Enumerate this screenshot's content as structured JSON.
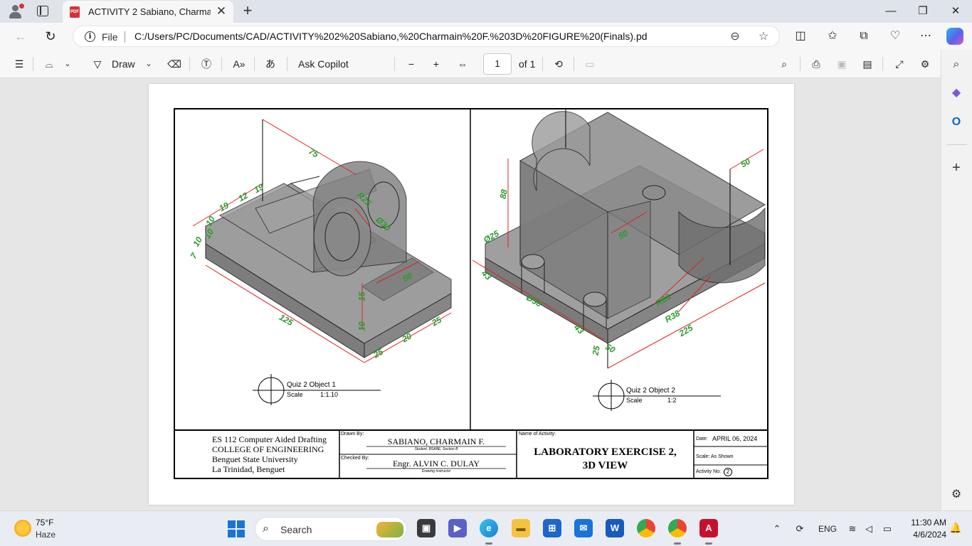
{
  "tab": {
    "title": "ACTIVITY 2 Sabiano, Charmain F.",
    "close": "✕",
    "new_tab": "+"
  },
  "window": {
    "minimize": "—",
    "restore": "❐",
    "close": "✕"
  },
  "address": {
    "file_label": "File",
    "url": "C:/Users/PC/Documents/CAD/ACTIVITY%202%20Sabiano,%20Charmain%20F.%203D%20FIGURE%20(Finals).pdf"
  },
  "pdf_toolbar": {
    "draw": "Draw",
    "ask_copilot": "Ask Copilot",
    "page_current": "1",
    "page_total": "of 1"
  },
  "drawing": {
    "object1": {
      "title": "Quiz 2 Object 1",
      "scale_label": "Scale",
      "scale_value": "1:1.10",
      "dims": [
        "75",
        "19",
        "12",
        "19",
        "10",
        "10",
        "10",
        "7",
        "R25",
        "Ø30",
        "50",
        "15",
        "10",
        "125",
        "25",
        "20",
        "25"
      ]
    },
    "object2": {
      "title": "Quiz 2 Object 2",
      "scale_label": "Scale",
      "scale_value": "1:2",
      "dims": [
        "50",
        "88",
        "Ø25",
        "50",
        "43",
        "Ø30",
        "R63",
        "R38",
        "225",
        "43",
        "25",
        "50"
      ]
    },
    "titleblock": {
      "course": "ES 112 Computer Aided Drafting",
      "college": "COLLEGE OF ENGINEERING",
      "university": "Benguet State University",
      "location": "La Trinidad, Benguet",
      "drawn_by_label": "Drawn By:",
      "drawn_by": "SABIANO, CHARMAIN F.",
      "drawn_by_sub": "Student, BSABE, Section B",
      "checked_by_label": "Checked By:",
      "checked_by": "Engr. ALVIN C. DULAY",
      "checked_by_sub": "Drawing Instructor",
      "activity_label": "Name of Activity:",
      "activity_line1": "LABORATORY EXERCISE 2,",
      "activity_line2": "3D VIEW",
      "date_label": "Date:",
      "date_value": "APRIL 06, 2024",
      "scale_text": "Scale: As Shown",
      "activity_no_label": "Activity No:",
      "activity_no": "2"
    }
  },
  "taskbar": {
    "temp": "75°F",
    "weather": "Haze",
    "search": "Search",
    "lang": "ENG",
    "time": "11:30 AM",
    "date": "4/6/2024"
  },
  "colors": {
    "dimension": "#e02020",
    "dim_text": "#2a9a2a",
    "solid": "#8e8e8e",
    "accent": "#0067c0"
  }
}
